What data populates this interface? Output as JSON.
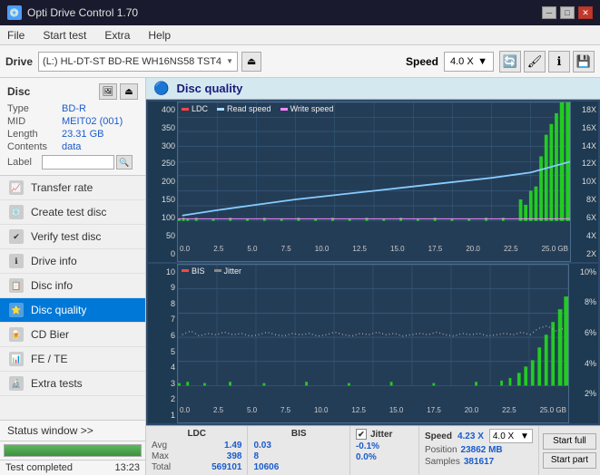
{
  "app": {
    "title": "Opti Drive Control 1.70",
    "icon": "💿"
  },
  "titlebar": {
    "minimize": "─",
    "maximize": "□",
    "close": "✕"
  },
  "menubar": {
    "items": [
      "File",
      "Start test",
      "Extra",
      "Help"
    ]
  },
  "toolbar": {
    "drive_label": "Drive",
    "drive_value": "(L:)  HL-DT-ST BD-RE  WH16NS58 TST4",
    "speed_label": "Speed",
    "speed_value": "4.0 X",
    "eject_icon": "⏏"
  },
  "disc": {
    "title": "Disc",
    "type_label": "Type",
    "type_value": "BD-R",
    "mid_label": "MID",
    "mid_value": "MEIT02 (001)",
    "length_label": "Length",
    "length_value": "23.31 GB",
    "contents_label": "Contents",
    "contents_value": "data",
    "label_label": "Label"
  },
  "nav": {
    "items": [
      {
        "id": "transfer-rate",
        "label": "Transfer rate",
        "icon": "📈"
      },
      {
        "id": "create-test-disc",
        "label": "Create test disc",
        "icon": "💿"
      },
      {
        "id": "verify-test-disc",
        "label": "Verify test disc",
        "icon": "✔"
      },
      {
        "id": "drive-info",
        "label": "Drive info",
        "icon": "ℹ"
      },
      {
        "id": "disc-info",
        "label": "Disc info",
        "icon": "📋"
      },
      {
        "id": "disc-quality",
        "label": "Disc quality",
        "icon": "⭐",
        "active": true
      },
      {
        "id": "cd-bier",
        "label": "CD Bier",
        "icon": "🍺"
      },
      {
        "id": "fe-te",
        "label": "FE / TE",
        "icon": "📊"
      },
      {
        "id": "extra-tests",
        "label": "Extra tests",
        "icon": "🔬"
      }
    ]
  },
  "status": {
    "window_label": "Status window >>",
    "progress_percent": "100.0%",
    "progress_value": 100,
    "status_text": "Test completed",
    "time": "13:23"
  },
  "disc_quality": {
    "title": "Disc quality",
    "chart1": {
      "legend": [
        "LDC",
        "Read speed",
        "Write speed"
      ],
      "y_labels_left": [
        "400",
        "350",
        "300",
        "250",
        "200",
        "150",
        "100",
        "50",
        "0"
      ],
      "y_labels_right": [
        "18X",
        "16X",
        "14X",
        "12X",
        "10X",
        "8X",
        "6X",
        "4X",
        "2X"
      ],
      "x_labels": [
        "0.0",
        "2.5",
        "5.0",
        "7.5",
        "10.0",
        "12.5",
        "15.0",
        "17.5",
        "20.0",
        "22.5",
        "25.0 GB"
      ]
    },
    "chart2": {
      "legend": [
        "BIS",
        "Jitter"
      ],
      "y_labels_left": [
        "10",
        "9",
        "8",
        "7",
        "6",
        "5",
        "4",
        "3",
        "2",
        "1"
      ],
      "y_labels_right": [
        "10%",
        "8%",
        "6%",
        "4%",
        "2%"
      ],
      "x_labels": [
        "0.0",
        "2.5",
        "5.0",
        "7.5",
        "10.0",
        "12.5",
        "15.0",
        "17.5",
        "20.0",
        "22.5",
        "25.0 GB"
      ]
    },
    "stats": {
      "ldc_header": "LDC",
      "bis_header": "BIS",
      "jitter_header": "Jitter",
      "speed_header": "Speed",
      "avg_label": "Avg",
      "max_label": "Max",
      "total_label": "Total",
      "ldc_avg": "1.49",
      "ldc_max": "398",
      "ldc_total": "569101",
      "bis_avg": "0.03",
      "bis_max": "8",
      "bis_total": "10606",
      "jitter_avg": "-0.1%",
      "jitter_max": "0.0%",
      "speed_value": "4.23 X",
      "speed_dropdown": "4.0 X",
      "position_label": "Position",
      "position_value": "23862 MB",
      "samples_label": "Samples",
      "samples_value": "381617",
      "start_full": "Start full",
      "start_part": "Start part"
    }
  }
}
